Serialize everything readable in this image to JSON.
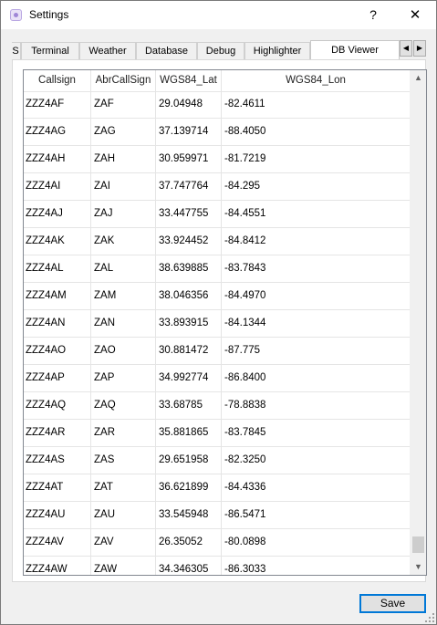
{
  "window": {
    "title": "Settings",
    "help_label": "?",
    "close_label": "✕"
  },
  "tabs": [
    {
      "label": "S",
      "active": false
    },
    {
      "label": "Terminal",
      "active": false
    },
    {
      "label": "Weather",
      "active": false
    },
    {
      "label": "Database",
      "active": false
    },
    {
      "label": "Debug",
      "active": false
    },
    {
      "label": "Highlighter",
      "active": false
    },
    {
      "label": "DB Viewer",
      "active": true
    }
  ],
  "tab_scroll": {
    "left": "◀",
    "right": "▶"
  },
  "table": {
    "columns": [
      "Callsign",
      "AbrCallSign",
      "WGS84_Lat",
      "WGS84_Lon"
    ],
    "rows": [
      [
        "ZZZ4AF",
        "ZAF",
        "29.04948",
        "-82.4611"
      ],
      [
        "ZZZ4AG",
        "ZAG",
        "37.139714",
        "-88.4050"
      ],
      [
        "ZZZ4AH",
        "ZAH",
        "30.959971",
        "-81.7219"
      ],
      [
        "ZZZ4AI",
        "ZAI",
        "37.747764",
        "-84.295"
      ],
      [
        "ZZZ4AJ",
        "ZAJ",
        "33.447755",
        "-84.4551"
      ],
      [
        "ZZZ4AK",
        "ZAK",
        "33.924452",
        "-84.8412"
      ],
      [
        "ZZZ4AL",
        "ZAL",
        "38.639885",
        "-83.7843"
      ],
      [
        "ZZZ4AM",
        "ZAM",
        "38.046356",
        "-84.4970"
      ],
      [
        "ZZZ4AN",
        "ZAN",
        "33.893915",
        "-84.1344"
      ],
      [
        "ZZZ4AO",
        "ZAO",
        "30.881472",
        "-87.775"
      ],
      [
        "ZZZ4AP",
        "ZAP",
        "34.992774",
        "-86.8400"
      ],
      [
        "ZZZ4AQ",
        "ZAQ",
        "33.68785",
        "-78.8838"
      ],
      [
        "ZZZ4AR",
        "ZAR",
        "35.881865",
        "-83.7845"
      ],
      [
        "ZZZ4AS",
        "ZAS",
        "29.651958",
        "-82.3250"
      ],
      [
        "ZZZ4AT",
        "ZAT",
        "36.621899",
        "-84.4336"
      ],
      [
        "ZZZ4AU",
        "ZAU",
        "33.545948",
        "-86.5471"
      ],
      [
        "ZZZ4AV",
        "ZAV",
        "26.35052",
        "-80.0898"
      ],
      [
        "ZZZ4AW",
        "ZAW",
        "34.346305",
        "-86.3033"
      ]
    ]
  },
  "scrollbar": {
    "up": "▲",
    "down": "▼"
  },
  "footer": {
    "save_label": "Save"
  },
  "colors": {
    "accent": "#0078d7",
    "grid_line": "#e5e5e5",
    "window_bg": "#f0f0f0"
  }
}
